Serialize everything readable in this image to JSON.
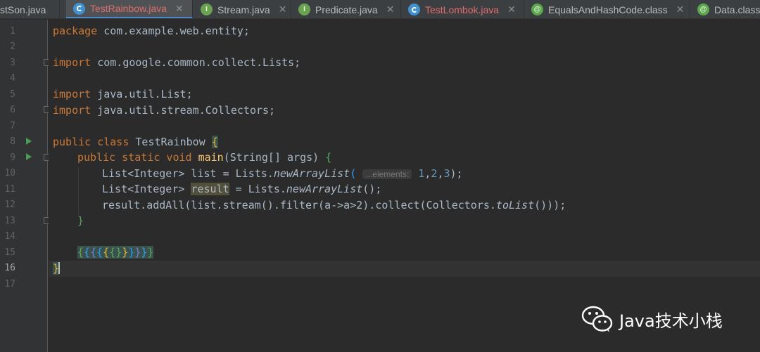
{
  "tabs": [
    {
      "label": "stSon.java",
      "icon": "none",
      "color": "#bbbbbb",
      "left": 0
    },
    {
      "label": "TestRainbow.java",
      "icon": "class-icon",
      "color": "#e06c6c",
      "active": true
    },
    {
      "label": "Stream.java",
      "icon": "interface-icon",
      "color": "#bbbbbb"
    },
    {
      "label": "Predicate.java",
      "icon": "interface-icon",
      "color": "#bbbbbb"
    },
    {
      "label": "TestLombok.java",
      "icon": "class-icon",
      "color": "#e06c6c"
    },
    {
      "label": "EqualsAndHashCode.class",
      "icon": "annotation-icon",
      "color": "#bbbbbb"
    },
    {
      "label": "Data.class",
      "icon": "annotation-icon",
      "color": "#bbbbbb"
    }
  ],
  "line_numbers": [
    "1",
    "2",
    "3",
    "4",
    "5",
    "6",
    "7",
    "8",
    "9",
    "10",
    "11",
    "12",
    "13",
    "14",
    "15",
    "16",
    "17"
  ],
  "code": {
    "l1_kw": "package",
    "l1_rest": " com.example.web.entity;",
    "l3_kw": "import",
    "l3_rest": " com.google.common.collect.Lists;",
    "l5_kw": "import",
    "l5_rest": " java.util.List;",
    "l6_kw": "import",
    "l6_rest": " java.util.stream.Collectors;",
    "l8_kw": "public class",
    "l8_name": " TestRainbow ",
    "l8_brace": "{",
    "l9_kw": "public static void",
    "l9_fn": "main",
    "l9_rest": "(String[] args) ",
    "l9_brace": "{",
    "l10_a": "List<Integer> list = Lists.",
    "l10_method": "newArrayList",
    "l10_paren": "(",
    "l10_hint": "...elements:",
    "l10_n1": "1",
    "l10_n2": "2",
    "l10_n3": "3",
    "l10_end": ");",
    "l11_a": "List<Integer> ",
    "l11_var": "result",
    "l11_b": " = Lists.",
    "l11_method": "newArrayList",
    "l11_end": "();",
    "l12_a": "result.addAll(list.stream().filter(a->a>2).collect(Collectors.",
    "l12_method": "toList",
    "l12_end": "()));",
    "l13_brace": "}",
    "l15_b1": "{",
    "l15_b2": "{",
    "l15_b3": "{",
    "l15_b4": "{",
    "l15_b5": "{",
    "l15_b6": "{",
    "l15_c6": "}",
    "l15_c5": "}",
    "l15_c4": "}",
    "l15_c3": "}",
    "l15_c2": "}",
    "l15_c1": "}",
    "l16_brace": "}"
  },
  "watermark": {
    "text": "Java技术小栈",
    "icon": "wechat-icon"
  }
}
